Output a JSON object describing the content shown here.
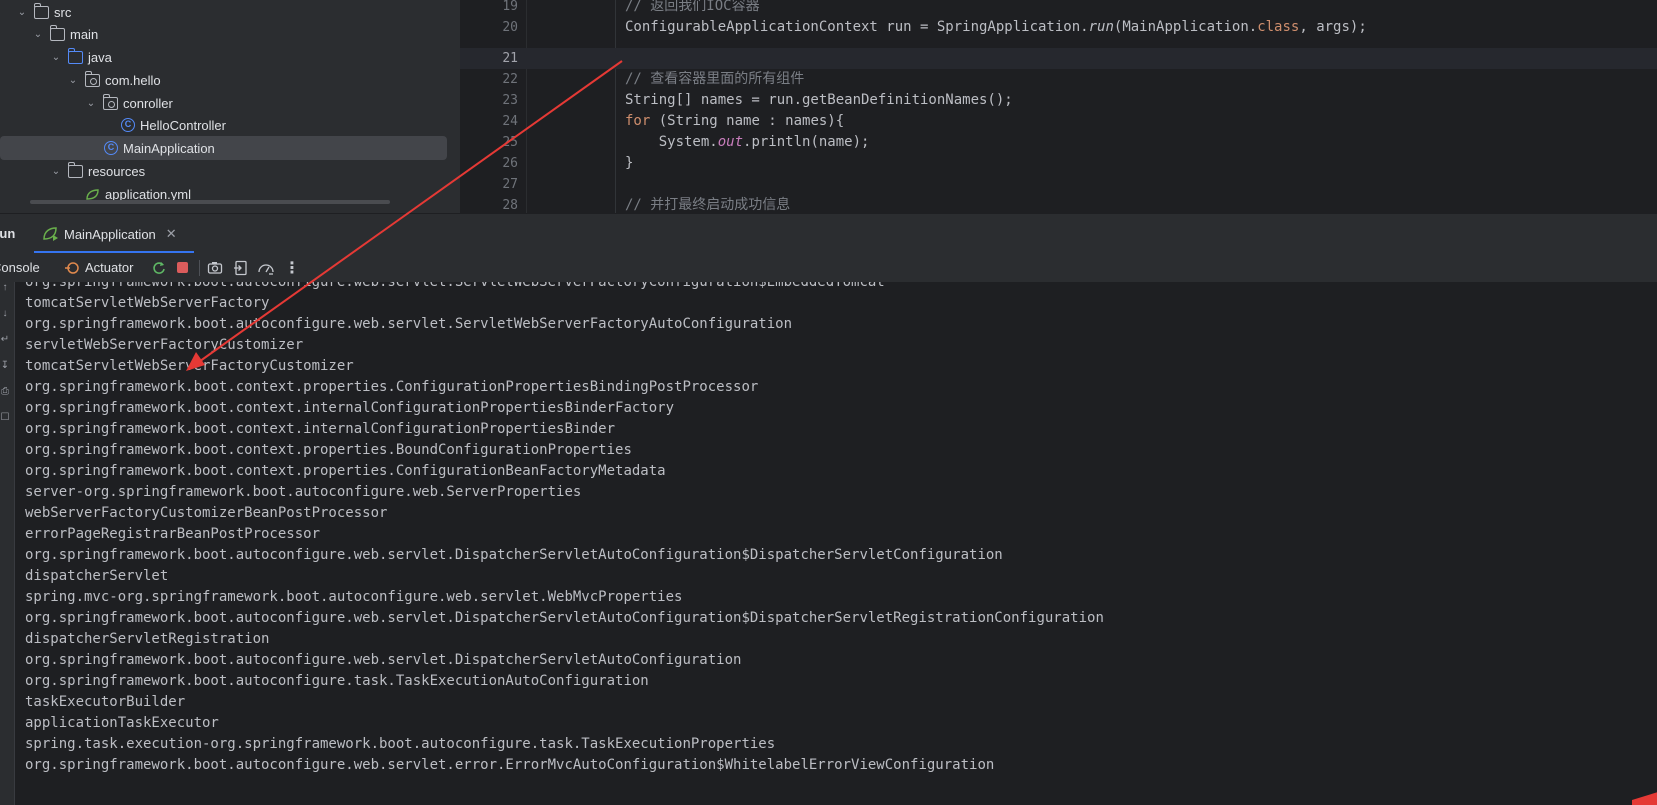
{
  "project_tree": {
    "items": [
      {
        "label": "src",
        "icon": "folder-icon",
        "expanded": true
      },
      {
        "label": "main",
        "icon": "folder-icon",
        "expanded": true
      },
      {
        "label": "java",
        "icon": "source-folder-icon",
        "expanded": true
      },
      {
        "label": "com.hello",
        "icon": "package-icon",
        "expanded": true
      },
      {
        "label": "conroller",
        "icon": "package-icon",
        "expanded": true
      },
      {
        "label": "HelloController",
        "icon": "class-icon"
      },
      {
        "label": "MainApplication",
        "icon": "spring-boot-class-icon",
        "selected": true
      },
      {
        "label": "resources",
        "icon": "resources-folder-icon",
        "expanded": true
      },
      {
        "label": "application.yml",
        "icon": "spring-config-icon"
      }
    ]
  },
  "editor": {
    "line_numbers": [
      "19",
      "20",
      "21",
      "22",
      "23",
      "24",
      "25",
      "26",
      "27",
      "28"
    ],
    "current_line": "21",
    "lines": {
      "l19": {
        "comment": "// 返回我们IOC容器"
      },
      "l20": {
        "a": "ConfigurableApplicationContext run = SpringApplication.",
        "method": "run",
        "b": "(MainApplication.",
        "kw": "class",
        "c": ", args);"
      },
      "l21": {},
      "l22": {
        "comment": "// 查看容器里面的所有组件"
      },
      "l23": {
        "a": "String[] names = run.getBeanDefinitionNames();"
      },
      "l24": {
        "kw": "for",
        "a": " (String name : names){"
      },
      "l25": {
        "a": "    System.",
        "field": "out",
        "b": ".println(name);"
      },
      "l26": {
        "a": "}"
      },
      "l28": {
        "comment": "// 并打最终启动成功信息"
      }
    }
  },
  "run_window": {
    "title": "Run",
    "tab_label": "MainApplication",
    "tab_icon": "spring-boot-run-icon",
    "toolbar": {
      "console_label": "Console",
      "actuator_label": "Actuator",
      "icons": [
        "rerun-icon",
        "stop-icon",
        "screenshot-icon",
        "export-icon",
        "gauge-icon",
        "more-icon"
      ]
    },
    "accent_color": "#3574f0",
    "stop_color": "#db5c5c"
  },
  "console": {
    "lines": [
      "org.springframework.boot.autoconfigure.web.servlet.ServletWebServerFactoryConfiguration$EmbeddedTomcat",
      "tomcatServletWebServerFactory",
      "org.springframework.boot.autoconfigure.web.servlet.ServletWebServerFactoryAutoConfiguration",
      "servletWebServerFactoryCustomizer",
      "tomcatServletWebServerFactoryCustomizer",
      "org.springframework.boot.context.properties.ConfigurationPropertiesBindingPostProcessor",
      "org.springframework.boot.context.internalConfigurationPropertiesBinderFactory",
      "org.springframework.boot.context.internalConfigurationPropertiesBinder",
      "org.springframework.boot.context.properties.BoundConfigurationProperties",
      "org.springframework.boot.context.properties.ConfigurationBeanFactoryMetadata",
      "server-org.springframework.boot.autoconfigure.web.ServerProperties",
      "webServerFactoryCustomizerBeanPostProcessor",
      "errorPageRegistrarBeanPostProcessor",
      "org.springframework.boot.autoconfigure.web.servlet.DispatcherServletAutoConfiguration$DispatcherServletConfiguration",
      "dispatcherServlet",
      "spring.mvc-org.springframework.boot.autoconfigure.web.servlet.WebMvcProperties",
      "org.springframework.boot.autoconfigure.web.servlet.DispatcherServletAutoConfiguration$DispatcherServletRegistrationConfiguration",
      "dispatcherServletRegistration",
      "org.springframework.boot.autoconfigure.web.servlet.DispatcherServletAutoConfiguration",
      "org.springframework.boot.autoconfigure.task.TaskExecutionAutoConfiguration",
      "taskExecutorBuilder",
      "applicationTaskExecutor",
      "spring.task.execution-org.springframework.boot.autoconfigure.task.TaskExecutionProperties",
      "org.springframework.boot.autoconfigure.web.servlet.error.ErrorMvcAutoConfiguration$WhitelabelErrorViewConfiguration"
    ]
  },
  "annotation": {
    "arrow_color": "#e53935"
  }
}
